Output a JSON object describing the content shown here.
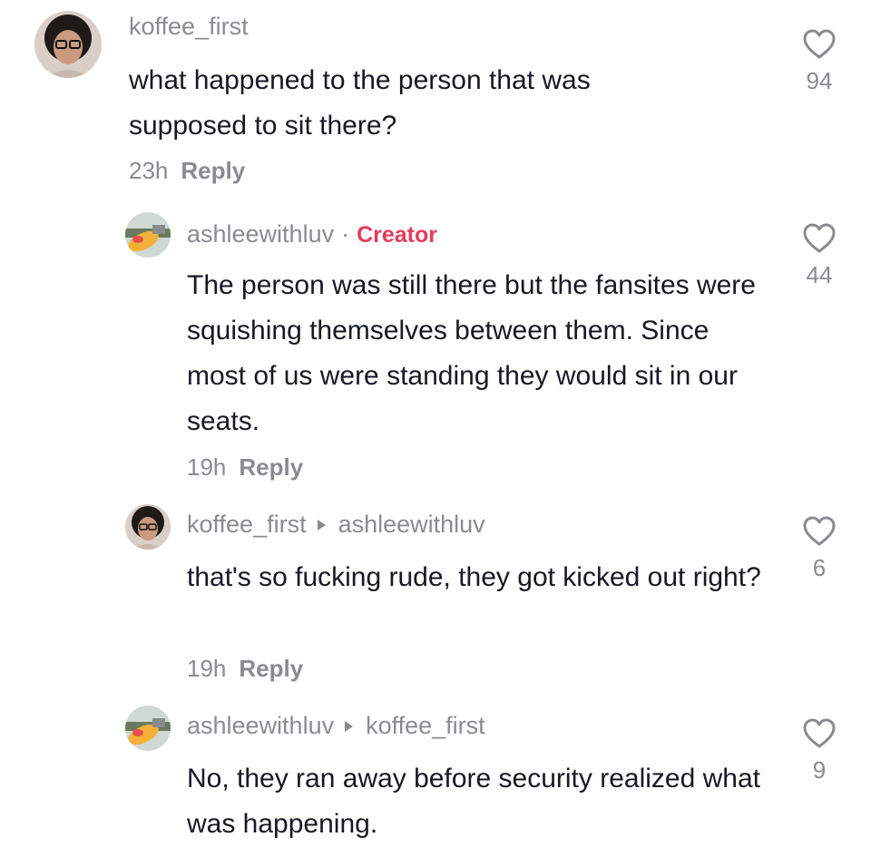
{
  "comments": [
    {
      "username": "koffee_first",
      "text": "what happened to the person that was supposed to sit there?",
      "time": "23h",
      "reply_label": "Reply",
      "likes": "94"
    },
    {
      "username": "ashleewithluv",
      "badge": "Creator",
      "separator": "·",
      "text": "The person was still there but the fansites were squishing themselves between them. Since most of us were standing they would sit in our seats.",
      "time": "19h",
      "reply_label": "Reply",
      "likes": "44"
    },
    {
      "username": "koffee_first",
      "reply_to": "ashleewithluv",
      "text": "that's so fucking rude, they got kicked out right?",
      "time": "19h",
      "reply_label": "Reply",
      "likes": "6"
    },
    {
      "username": "ashleewithluv",
      "reply_to": "koffee_first",
      "text": "No, they ran away before security realized what was happening.",
      "likes": "9"
    }
  ],
  "colors": {
    "username": "#8a8b91",
    "creator_badge": "#e63a5b",
    "body_text": "#161823"
  },
  "icons": {
    "like": "heart-outline-icon",
    "reply_arrow": "triangle-right-icon"
  }
}
